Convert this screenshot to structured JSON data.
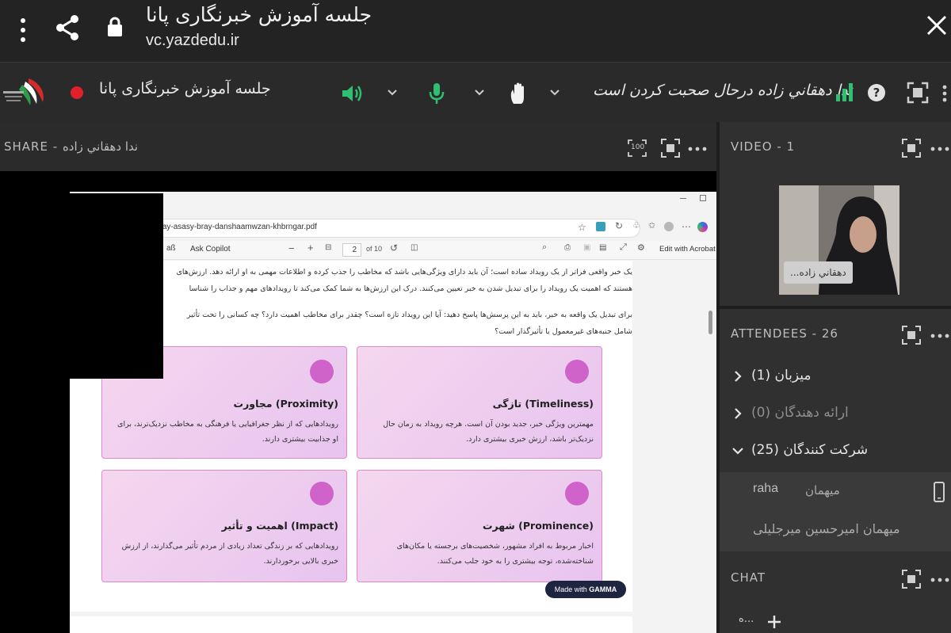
{
  "topbar": {
    "title": "جلسه آموزش خبرنگاری پانا",
    "url": "vc.yazdedu.ir"
  },
  "meeting": {
    "title": "جلسه آموزش خبرنگاری پانا",
    "speaking": "ندا دهقاني زاده درحال صحبت کردن است",
    "recording_color": "#e0212b",
    "mic_color": "#2fbf71"
  },
  "share": {
    "label": "SHARE",
    "presenter": "ندا دهقاني زاده",
    "zoom_badge": "100"
  },
  "pdf": {
    "url": "h-khbrngary-mharthay-asasy-bray-danshaamwzan-khbrngar.pdf",
    "ask_copilot": "Ask Copilot",
    "page_current": "2",
    "page_total": "of 10",
    "edit_with": "Edit with Acrobat",
    "para1_line1": "یک خبر واقعی فراتر از یک رویداد ساده است؛ آن باید دارای ویژگی‌هایی باشد که مخاطب را جذب کرده و اطلاعات مهمی به او ارائه دهد. ارزش‌های",
    "para1_line2": "هستند که اهمیت یک رویداد را برای تبدیل شدن به خبر تعیین می‌کنند. درک این ارزش‌ها به شما کمک می‌کند تا رویدادهای مهم و جذاب را شناسا",
    "para2_line1": "برای تبدیل یک واقعه به خبر، باید به این پرسش‌ها پاسخ دهید: آیا این رویداد تازه است؟ چقدر برای مخاطب اهمیت دارد؟ چه کسانی را تحت تأثیر",
    "para2_line2": "شامل جنبه‌های غیرمعمول یا تأثیرگذار است؟",
    "cards": [
      {
        "title": "تازگی (Timeliness)",
        "body": "مهمترین ویژگی خبر، جدید بودن آن است. هرچه رویداد به زمان حال نزدیک‌تر باشد، ارزش خبری بیشتری دارد."
      },
      {
        "title": "مجاورت (Proximity)",
        "body": "رویدادهایی که از نظر جغرافیایی یا فرهنگی به مخاطب نزدیک‌ترند، برای او جذابیت بیشتری دارند."
      },
      {
        "title": "شهرت (Prominence)",
        "body": "اخبار مربوط به افراد مشهور، شخصیت‌های برجسته یا مکان‌های شناخته‌شده، توجه بیشتری را به خود جلب می‌کنند."
      },
      {
        "title": "اهمیت و تأثیر (Impact)",
        "body": "رویدادهایی که بر زندگی تعداد زیادی از مردم تأثیر می‌گذارند، از ارزش خبری بالایی برخوردارند."
      }
    ],
    "made_with": "Made with",
    "gamma": "GAMMA"
  },
  "video": {
    "label": "VIDEO",
    "count": "- 1",
    "name_tag": "...دهقاني زاده"
  },
  "attendees": {
    "label": "ATTENDEES",
    "count": "- 26",
    "groups": [
      {
        "label": "میزبان (1)"
      },
      {
        "label": "ارائه دهندگان (0)"
      },
      {
        "label": "شرکت کنندگان (25)"
      }
    ],
    "people": [
      {
        "name": "raha",
        "role": "میهمان"
      },
      {
        "name": "میهمان امیرحسین میرجلیلی"
      }
    ]
  },
  "chat": {
    "label": "CHAT",
    "partial": "ه..."
  }
}
